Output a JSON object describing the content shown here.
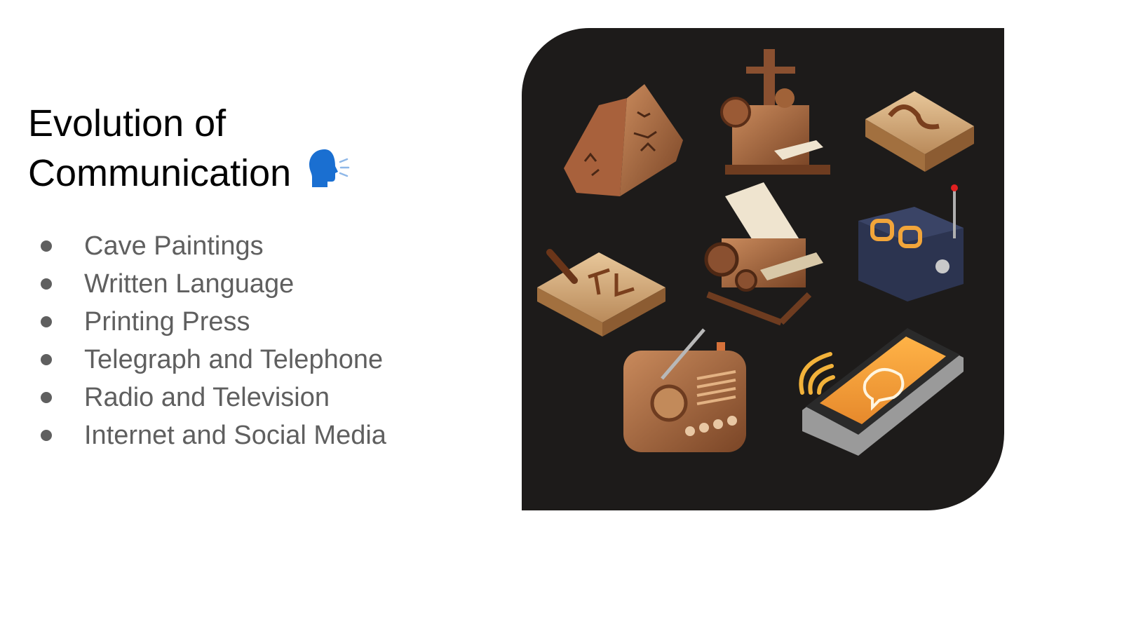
{
  "slide": {
    "title_line_1": "Evolution of",
    "title_line_2": "Communication",
    "title_icon": "speaking-head-icon",
    "bullets": [
      "Cave Paintings",
      "Written Language",
      "Printing Press",
      "Telegraph and Telephone",
      "Radio and Television",
      "Internet and Social Media"
    ],
    "illustration": {
      "items": [
        "cave-painting-rock-icon",
        "printing-press-icon",
        "clay-tablet-icon",
        "stylus-tablet-icon",
        "typewriter-icon",
        "telegraph-counter-icon",
        "radio-icon",
        "smartphone-icon"
      ]
    }
  },
  "colors": {
    "title": "#000000",
    "bullet_text": "#5f5f5f",
    "panel_background": "#1d1b1a",
    "accent_orange": "#f2a53a"
  }
}
